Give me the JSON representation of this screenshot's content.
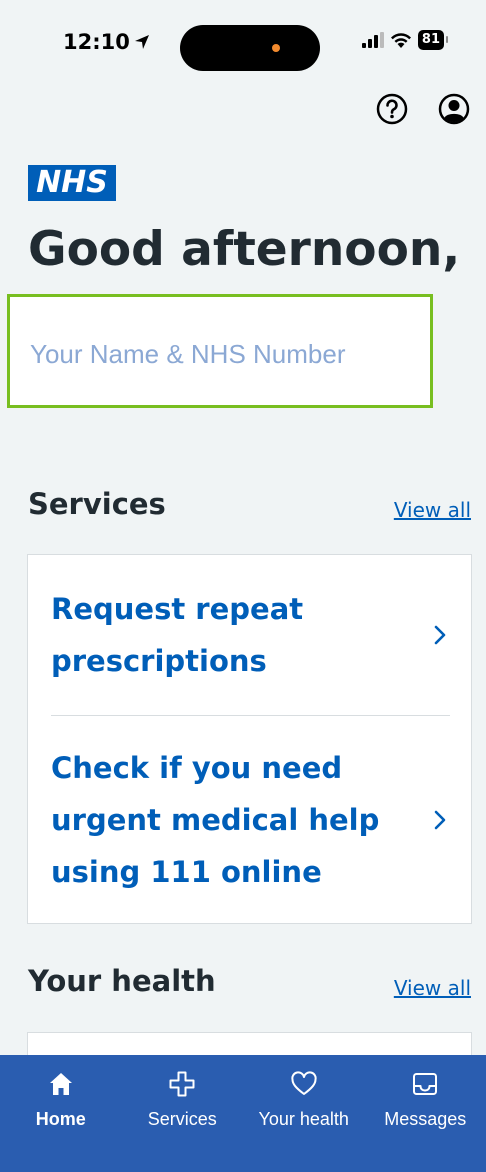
{
  "status_bar": {
    "time": "12:10",
    "battery": "81"
  },
  "header": {
    "logo_text": "NHS",
    "greeting": "Good afternoon,",
    "name_placeholder": "Your Name & NHS Number"
  },
  "services": {
    "title": "Services",
    "view_all": "View all",
    "items": [
      {
        "label": "Request repeat prescriptions"
      },
      {
        "label": "Check if you need urgent medical help using 111 online"
      }
    ]
  },
  "your_health": {
    "title": "Your health",
    "view_all": "View all"
  },
  "bottom_nav": {
    "items": [
      {
        "label": "Home",
        "icon": "home-icon",
        "active": true
      },
      {
        "label": "Services",
        "icon": "plus-cross-icon",
        "active": false
      },
      {
        "label": "Your health",
        "icon": "heart-icon",
        "active": false
      },
      {
        "label": "Messages",
        "icon": "inbox-icon",
        "active": false
      }
    ]
  },
  "colors": {
    "nhs_blue": "#005eb8",
    "nav_blue": "#2a5db0",
    "background": "#f0f4f5",
    "highlight_border": "#78be20"
  }
}
